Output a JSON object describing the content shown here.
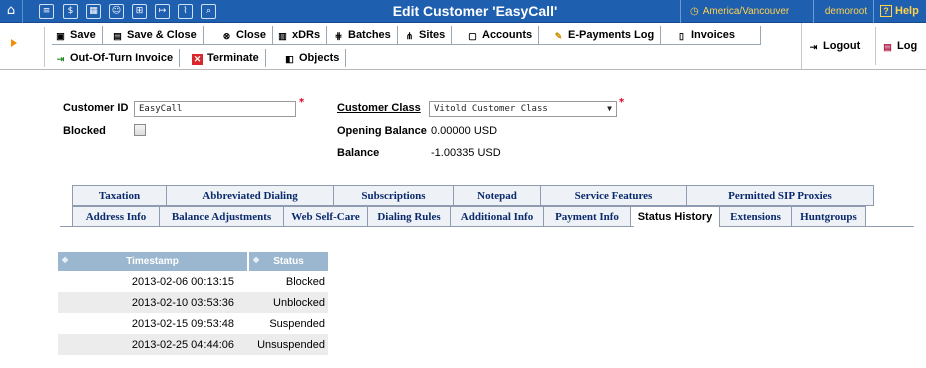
{
  "window": {
    "title": "Edit Customer 'EasyCall'",
    "timezone": "America/Vancouver",
    "user": "demoroot",
    "help_label": "Help"
  },
  "toolbar": {
    "row1": [
      {
        "label": "Save",
        "icon": "save-icon"
      },
      {
        "label": "Save & Close",
        "icon": "save-close-icon"
      },
      {
        "label": "Close",
        "icon": "close-icon"
      },
      {
        "label": "xDRs",
        "icon": "xdrs-icon"
      },
      {
        "label": "Batches",
        "icon": "batches-icon"
      },
      {
        "label": "Sites",
        "icon": "sites-icon"
      },
      {
        "label": "Accounts",
        "icon": "accounts-icon"
      },
      {
        "label": "E-Payments Log",
        "icon": "epayments-icon"
      },
      {
        "label": "Invoices",
        "icon": "invoices-icon"
      }
    ],
    "row2": [
      {
        "label": "Out-Of-Turn Invoice",
        "icon": "invoice-out-icon"
      },
      {
        "label": "Terminate",
        "icon": "terminate-icon"
      },
      {
        "label": "Objects",
        "icon": "objects-icon"
      }
    ],
    "logout_label": "Logout",
    "log_label": "Log"
  },
  "form": {
    "customer_id_label": "Customer ID",
    "customer_id_value": "EasyCall",
    "blocked_label": "Blocked",
    "blocked_checked": false,
    "customer_class_label": "Customer Class",
    "customer_class_value": "Vitold Customer Class",
    "opening_balance_label": "Opening Balance",
    "opening_balance_value": "0.00000 USD",
    "balance_label": "Balance",
    "balance_value": "-1.00335 USD"
  },
  "tabs": {
    "row1": [
      "Taxation",
      "Abbreviated Dialing",
      "Subscriptions",
      "Notepad",
      "Service Features",
      "Permitted SIP Proxies"
    ],
    "row2": [
      "Address Info",
      "Balance Adjustments",
      "Web Self-Care",
      "Dialing Rules",
      "Additional Info",
      "Payment Info",
      "Status History",
      "Extensions",
      "Huntgroups"
    ],
    "active": "Status History"
  },
  "status_history": {
    "columns": [
      "Timestamp",
      "Status"
    ],
    "rows": [
      [
        "2013-02-06 00:13:15",
        "Blocked"
      ],
      [
        "2013-02-10 03:53:36",
        "Unblocked"
      ],
      [
        "2013-02-15 09:53:48",
        "Suspended"
      ],
      [
        "2013-02-25 04:44:06",
        "Unsuspended"
      ]
    ]
  },
  "colors": {
    "topbar": "#1f5fb0",
    "accent_yellow": "#ffd24a",
    "table_header": "#9bb7cf",
    "tab_text": "#0a2a6e"
  }
}
